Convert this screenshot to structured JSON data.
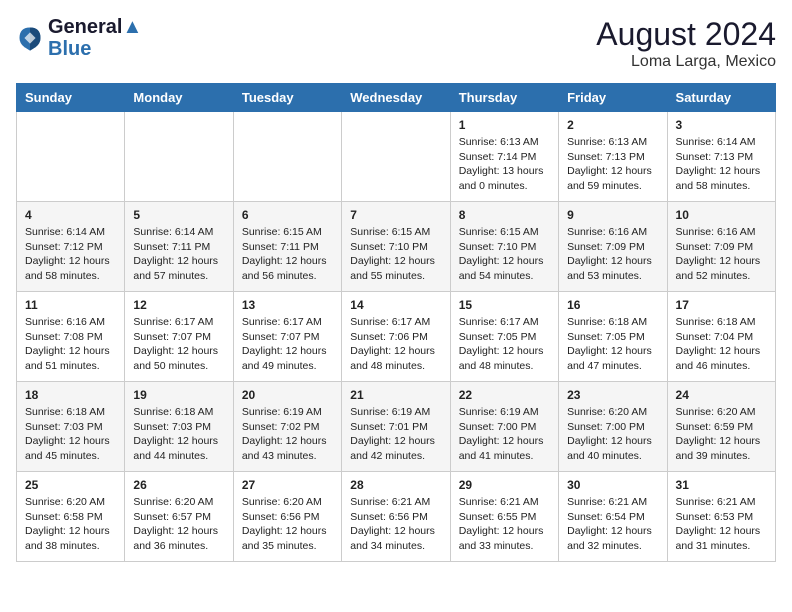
{
  "logo": {
    "line1": "General",
    "line2": "Blue"
  },
  "title": {
    "month_year": "August 2024",
    "location": "Loma Larga, Mexico"
  },
  "weekdays": [
    "Sunday",
    "Monday",
    "Tuesday",
    "Wednesday",
    "Thursday",
    "Friday",
    "Saturday"
  ],
  "weeks": [
    [
      {
        "day": "",
        "info": ""
      },
      {
        "day": "",
        "info": ""
      },
      {
        "day": "",
        "info": ""
      },
      {
        "day": "",
        "info": ""
      },
      {
        "day": "1",
        "info": "Sunrise: 6:13 AM\nSunset: 7:14 PM\nDaylight: 13 hours\nand 0 minutes."
      },
      {
        "day": "2",
        "info": "Sunrise: 6:13 AM\nSunset: 7:13 PM\nDaylight: 12 hours\nand 59 minutes."
      },
      {
        "day": "3",
        "info": "Sunrise: 6:14 AM\nSunset: 7:13 PM\nDaylight: 12 hours\nand 58 minutes."
      }
    ],
    [
      {
        "day": "4",
        "info": "Sunrise: 6:14 AM\nSunset: 7:12 PM\nDaylight: 12 hours\nand 58 minutes."
      },
      {
        "day": "5",
        "info": "Sunrise: 6:14 AM\nSunset: 7:11 PM\nDaylight: 12 hours\nand 57 minutes."
      },
      {
        "day": "6",
        "info": "Sunrise: 6:15 AM\nSunset: 7:11 PM\nDaylight: 12 hours\nand 56 minutes."
      },
      {
        "day": "7",
        "info": "Sunrise: 6:15 AM\nSunset: 7:10 PM\nDaylight: 12 hours\nand 55 minutes."
      },
      {
        "day": "8",
        "info": "Sunrise: 6:15 AM\nSunset: 7:10 PM\nDaylight: 12 hours\nand 54 minutes."
      },
      {
        "day": "9",
        "info": "Sunrise: 6:16 AM\nSunset: 7:09 PM\nDaylight: 12 hours\nand 53 minutes."
      },
      {
        "day": "10",
        "info": "Sunrise: 6:16 AM\nSunset: 7:09 PM\nDaylight: 12 hours\nand 52 minutes."
      }
    ],
    [
      {
        "day": "11",
        "info": "Sunrise: 6:16 AM\nSunset: 7:08 PM\nDaylight: 12 hours\nand 51 minutes."
      },
      {
        "day": "12",
        "info": "Sunrise: 6:17 AM\nSunset: 7:07 PM\nDaylight: 12 hours\nand 50 minutes."
      },
      {
        "day": "13",
        "info": "Sunrise: 6:17 AM\nSunset: 7:07 PM\nDaylight: 12 hours\nand 49 minutes."
      },
      {
        "day": "14",
        "info": "Sunrise: 6:17 AM\nSunset: 7:06 PM\nDaylight: 12 hours\nand 48 minutes."
      },
      {
        "day": "15",
        "info": "Sunrise: 6:17 AM\nSunset: 7:05 PM\nDaylight: 12 hours\nand 48 minutes."
      },
      {
        "day": "16",
        "info": "Sunrise: 6:18 AM\nSunset: 7:05 PM\nDaylight: 12 hours\nand 47 minutes."
      },
      {
        "day": "17",
        "info": "Sunrise: 6:18 AM\nSunset: 7:04 PM\nDaylight: 12 hours\nand 46 minutes."
      }
    ],
    [
      {
        "day": "18",
        "info": "Sunrise: 6:18 AM\nSunset: 7:03 PM\nDaylight: 12 hours\nand 45 minutes."
      },
      {
        "day": "19",
        "info": "Sunrise: 6:18 AM\nSunset: 7:03 PM\nDaylight: 12 hours\nand 44 minutes."
      },
      {
        "day": "20",
        "info": "Sunrise: 6:19 AM\nSunset: 7:02 PM\nDaylight: 12 hours\nand 43 minutes."
      },
      {
        "day": "21",
        "info": "Sunrise: 6:19 AM\nSunset: 7:01 PM\nDaylight: 12 hours\nand 42 minutes."
      },
      {
        "day": "22",
        "info": "Sunrise: 6:19 AM\nSunset: 7:00 PM\nDaylight: 12 hours\nand 41 minutes."
      },
      {
        "day": "23",
        "info": "Sunrise: 6:20 AM\nSunset: 7:00 PM\nDaylight: 12 hours\nand 40 minutes."
      },
      {
        "day": "24",
        "info": "Sunrise: 6:20 AM\nSunset: 6:59 PM\nDaylight: 12 hours\nand 39 minutes."
      }
    ],
    [
      {
        "day": "25",
        "info": "Sunrise: 6:20 AM\nSunset: 6:58 PM\nDaylight: 12 hours\nand 38 minutes."
      },
      {
        "day": "26",
        "info": "Sunrise: 6:20 AM\nSunset: 6:57 PM\nDaylight: 12 hours\nand 36 minutes."
      },
      {
        "day": "27",
        "info": "Sunrise: 6:20 AM\nSunset: 6:56 PM\nDaylight: 12 hours\nand 35 minutes."
      },
      {
        "day": "28",
        "info": "Sunrise: 6:21 AM\nSunset: 6:56 PM\nDaylight: 12 hours\nand 34 minutes."
      },
      {
        "day": "29",
        "info": "Sunrise: 6:21 AM\nSunset: 6:55 PM\nDaylight: 12 hours\nand 33 minutes."
      },
      {
        "day": "30",
        "info": "Sunrise: 6:21 AM\nSunset: 6:54 PM\nDaylight: 12 hours\nand 32 minutes."
      },
      {
        "day": "31",
        "info": "Sunrise: 6:21 AM\nSunset: 6:53 PM\nDaylight: 12 hours\nand 31 minutes."
      }
    ]
  ]
}
